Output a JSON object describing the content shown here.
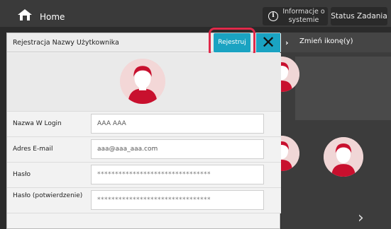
{
  "topbar": {
    "home_label": "Home",
    "info_label": "Informacje o systemie",
    "status_label": "Status Zadania"
  },
  "side_menu": {
    "change_icon_label": "Zmień ikonę(y)"
  },
  "dialog": {
    "title": "Rejestracja Nazwy Użytkownika",
    "register_label": "Rejestruj",
    "close_label": "✕",
    "fields": [
      {
        "label": "Nazwa W Login",
        "value": "AAA AAA"
      },
      {
        "label": "Adres E-mail",
        "value": "aaa@aaa_aaa.com"
      },
      {
        "label": "Hasło",
        "value": "********************************"
      },
      {
        "label": "Hasło (potwierdzenie)",
        "value": "********************************"
      }
    ]
  },
  "colors": {
    "accent": "#1aa3c2",
    "highlight": "#e0294a",
    "topbar": "#3a3a3a"
  }
}
